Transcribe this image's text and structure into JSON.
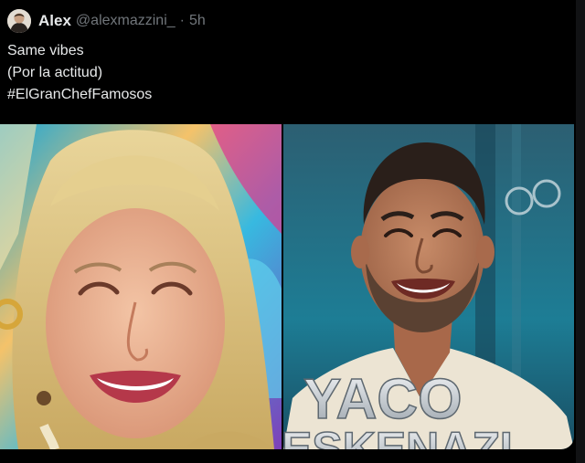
{
  "tweet": {
    "author_name": "Alex",
    "author_handle": "@alexmazzini_",
    "separator": "·",
    "timestamp": "5h",
    "text_lines": [
      "Same vibes",
      "(Por la actitud)",
      "#ElGranChefFamosos"
    ]
  },
  "media": {
    "right_image": {
      "overlay_top": "YACO",
      "overlay_bottom": "ESKENAZI"
    }
  }
}
